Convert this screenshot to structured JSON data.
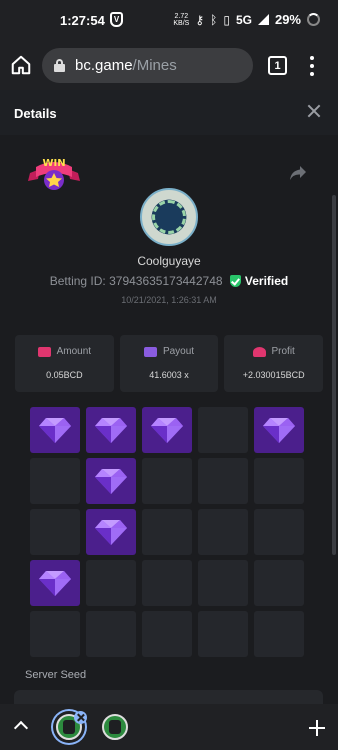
{
  "status_bar": {
    "time": "1:27:54",
    "vpn_glyph": "V",
    "speed_value": "2.72",
    "speed_unit": "KB/S",
    "network": "5G",
    "battery": "29%"
  },
  "browser": {
    "url_host": "bc.game",
    "url_path": "/Mines",
    "tab_count": "1"
  },
  "details": {
    "title": "Details",
    "username": "Coolguyaye",
    "betting_id_label": "Betting ID:",
    "betting_id": "37943635173442748",
    "verified_label": "Verified",
    "timestamp": "10/21/2021, 1:26:31 AM",
    "stats": [
      {
        "label": "Amount",
        "value": "0.05BCD",
        "icon": "amount-icon"
      },
      {
        "label": "Payout",
        "value": "41.6003 x",
        "icon": "payout-icon"
      },
      {
        "label": "Profit",
        "value": "+2.030015BCD",
        "icon": "profit-icon"
      }
    ],
    "mines_grid": {
      "rows": 5,
      "cols": 5,
      "gems": [
        [
          0,
          0
        ],
        [
          0,
          1
        ],
        [
          0,
          2
        ],
        [
          0,
          4
        ],
        [
          1,
          1
        ],
        [
          2,
          1
        ],
        [
          3,
          0
        ]
      ]
    },
    "server_seed_label": "Server Seed"
  },
  "colors": {
    "gem_tile": "#4b1f8c",
    "empty_tile": "#25272c",
    "verified_green": "#29c46a",
    "accent_pink": "#e0366f",
    "accent_purple": "#8a5ce0"
  }
}
